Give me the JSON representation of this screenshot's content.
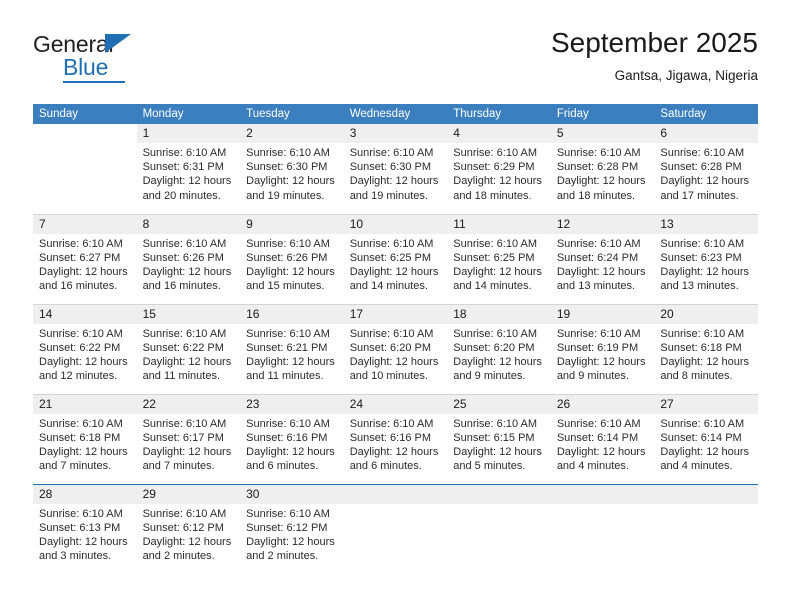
{
  "brand": {
    "name_top": "General",
    "name_bottom": "Blue",
    "accent_color": "#1f6fb2"
  },
  "header": {
    "title": "September 2025",
    "subtitle": "Gantsa, Jigawa, Nigeria"
  },
  "calendar": {
    "header_bg": "#3b7fbf",
    "daynum_bg": "#efefef",
    "weekday_names": [
      "Sunday",
      "Monday",
      "Tuesday",
      "Wednesday",
      "Thursday",
      "Friday",
      "Saturday"
    ],
    "weeks": [
      [
        {
          "day": "",
          "lines": [],
          "state": "blank"
        },
        {
          "day": "1",
          "lines": [
            "Sunrise: 6:10 AM",
            "Sunset: 6:31 PM",
            "Daylight: 12 hours",
            "and 20 minutes."
          ],
          "state": "filled"
        },
        {
          "day": "2",
          "lines": [
            "Sunrise: 6:10 AM",
            "Sunset: 6:30 PM",
            "Daylight: 12 hours",
            "and 19 minutes."
          ],
          "state": "filled"
        },
        {
          "day": "3",
          "lines": [
            "Sunrise: 6:10 AM",
            "Sunset: 6:30 PM",
            "Daylight: 12 hours",
            "and 19 minutes."
          ],
          "state": "filled"
        },
        {
          "day": "4",
          "lines": [
            "Sunrise: 6:10 AM",
            "Sunset: 6:29 PM",
            "Daylight: 12 hours",
            "and 18 minutes."
          ],
          "state": "filled"
        },
        {
          "day": "5",
          "lines": [
            "Sunrise: 6:10 AM",
            "Sunset: 6:28 PM",
            "Daylight: 12 hours",
            "and 18 minutes."
          ],
          "state": "filled"
        },
        {
          "day": "6",
          "lines": [
            "Sunrise: 6:10 AM",
            "Sunset: 6:28 PM",
            "Daylight: 12 hours",
            "and 17 minutes."
          ],
          "state": "filled"
        }
      ],
      [
        {
          "day": "7",
          "lines": [
            "Sunrise: 6:10 AM",
            "Sunset: 6:27 PM",
            "Daylight: 12 hours",
            "and 16 minutes."
          ],
          "state": "filled"
        },
        {
          "day": "8",
          "lines": [
            "Sunrise: 6:10 AM",
            "Sunset: 6:26 PM",
            "Daylight: 12 hours",
            "and 16 minutes."
          ],
          "state": "filled"
        },
        {
          "day": "9",
          "lines": [
            "Sunrise: 6:10 AM",
            "Sunset: 6:26 PM",
            "Daylight: 12 hours",
            "and 15 minutes."
          ],
          "state": "filled"
        },
        {
          "day": "10",
          "lines": [
            "Sunrise: 6:10 AM",
            "Sunset: 6:25 PM",
            "Daylight: 12 hours",
            "and 14 minutes."
          ],
          "state": "filled"
        },
        {
          "day": "11",
          "lines": [
            "Sunrise: 6:10 AM",
            "Sunset: 6:25 PM",
            "Daylight: 12 hours",
            "and 14 minutes."
          ],
          "state": "filled"
        },
        {
          "day": "12",
          "lines": [
            "Sunrise: 6:10 AM",
            "Sunset: 6:24 PM",
            "Daylight: 12 hours",
            "and 13 minutes."
          ],
          "state": "filled"
        },
        {
          "day": "13",
          "lines": [
            "Sunrise: 6:10 AM",
            "Sunset: 6:23 PM",
            "Daylight: 12 hours",
            "and 13 minutes."
          ],
          "state": "filled"
        }
      ],
      [
        {
          "day": "14",
          "lines": [
            "Sunrise: 6:10 AM",
            "Sunset: 6:22 PM",
            "Daylight: 12 hours",
            "and 12 minutes."
          ],
          "state": "filled"
        },
        {
          "day": "15",
          "lines": [
            "Sunrise: 6:10 AM",
            "Sunset: 6:22 PM",
            "Daylight: 12 hours",
            "and 11 minutes."
          ],
          "state": "filled"
        },
        {
          "day": "16",
          "lines": [
            "Sunrise: 6:10 AM",
            "Sunset: 6:21 PM",
            "Daylight: 12 hours",
            "and 11 minutes."
          ],
          "state": "filled"
        },
        {
          "day": "17",
          "lines": [
            "Sunrise: 6:10 AM",
            "Sunset: 6:20 PM",
            "Daylight: 12 hours",
            "and 10 minutes."
          ],
          "state": "filled"
        },
        {
          "day": "18",
          "lines": [
            "Sunrise: 6:10 AM",
            "Sunset: 6:20 PM",
            "Daylight: 12 hours",
            "and 9 minutes."
          ],
          "state": "filled"
        },
        {
          "day": "19",
          "lines": [
            "Sunrise: 6:10 AM",
            "Sunset: 6:19 PM",
            "Daylight: 12 hours",
            "and 9 minutes."
          ],
          "state": "filled"
        },
        {
          "day": "20",
          "lines": [
            "Sunrise: 6:10 AM",
            "Sunset: 6:18 PM",
            "Daylight: 12 hours",
            "and 8 minutes."
          ],
          "state": "filled"
        }
      ],
      [
        {
          "day": "21",
          "lines": [
            "Sunrise: 6:10 AM",
            "Sunset: 6:18 PM",
            "Daylight: 12 hours",
            "and 7 minutes."
          ],
          "state": "filled"
        },
        {
          "day": "22",
          "lines": [
            "Sunrise: 6:10 AM",
            "Sunset: 6:17 PM",
            "Daylight: 12 hours",
            "and 7 minutes."
          ],
          "state": "filled"
        },
        {
          "day": "23",
          "lines": [
            "Sunrise: 6:10 AM",
            "Sunset: 6:16 PM",
            "Daylight: 12 hours",
            "and 6 minutes."
          ],
          "state": "filled"
        },
        {
          "day": "24",
          "lines": [
            "Sunrise: 6:10 AM",
            "Sunset: 6:16 PM",
            "Daylight: 12 hours",
            "and 6 minutes."
          ],
          "state": "filled"
        },
        {
          "day": "25",
          "lines": [
            "Sunrise: 6:10 AM",
            "Sunset: 6:15 PM",
            "Daylight: 12 hours",
            "and 5 minutes."
          ],
          "state": "filled"
        },
        {
          "day": "26",
          "lines": [
            "Sunrise: 6:10 AM",
            "Sunset: 6:14 PM",
            "Daylight: 12 hours",
            "and 4 minutes."
          ],
          "state": "filled"
        },
        {
          "day": "27",
          "lines": [
            "Sunrise: 6:10 AM",
            "Sunset: 6:14 PM",
            "Daylight: 12 hours",
            "and 4 minutes."
          ],
          "state": "filled"
        }
      ],
      [
        {
          "day": "28",
          "lines": [
            "Sunrise: 6:10 AM",
            "Sunset: 6:13 PM",
            "Daylight: 12 hours",
            "and 3 minutes."
          ],
          "state": "filled"
        },
        {
          "day": "29",
          "lines": [
            "Sunrise: 6:10 AM",
            "Sunset: 6:12 PM",
            "Daylight: 12 hours",
            "and 2 minutes."
          ],
          "state": "filled"
        },
        {
          "day": "30",
          "lines": [
            "Sunrise: 6:10 AM",
            "Sunset: 6:12 PM",
            "Daylight: 12 hours",
            "and 2 minutes."
          ],
          "state": "filled"
        },
        {
          "day": "",
          "lines": [],
          "state": "empty"
        },
        {
          "day": "",
          "lines": [],
          "state": "empty"
        },
        {
          "day": "",
          "lines": [],
          "state": "empty"
        },
        {
          "day": "",
          "lines": [],
          "state": "empty"
        }
      ]
    ]
  }
}
